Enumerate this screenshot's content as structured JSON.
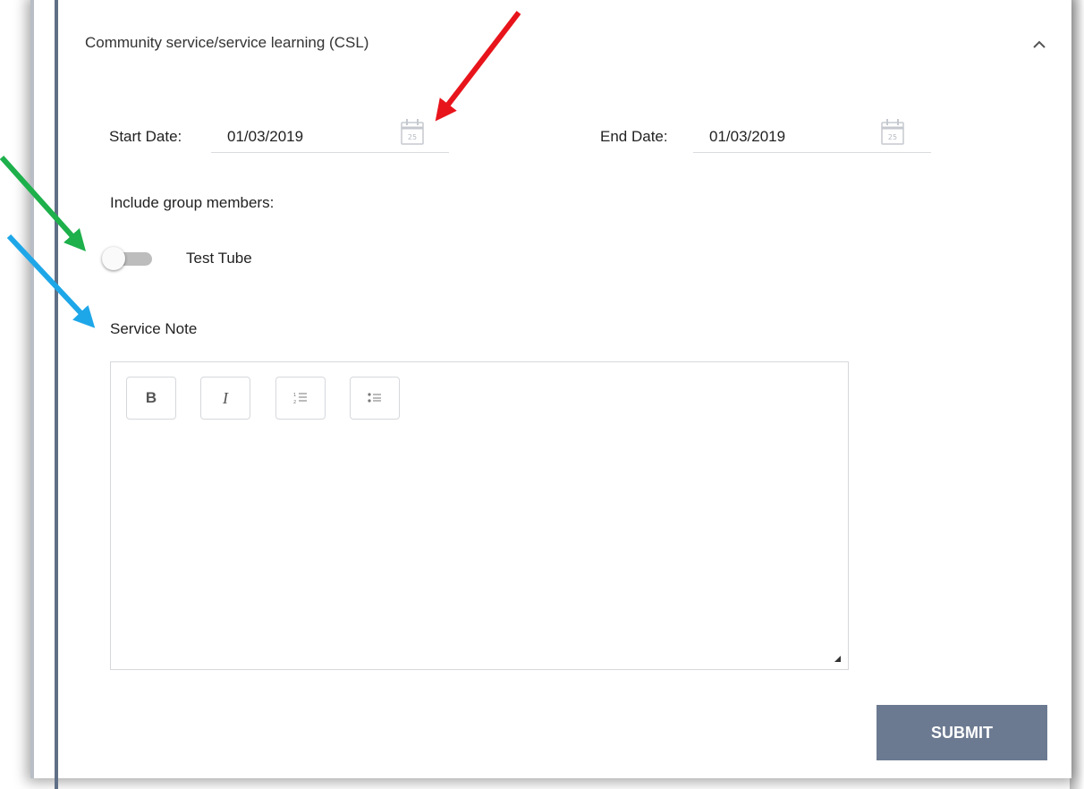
{
  "section": {
    "title": "Community service/service learning (CSL)"
  },
  "dates": {
    "start_label": "Start Date:",
    "start_value": "01/03/2019",
    "end_label": "End Date:",
    "end_value": "01/03/2019",
    "calendar_day": "25"
  },
  "group": {
    "label": "Include group members:",
    "members": [
      {
        "name": "Test Tube",
        "included": false
      }
    ]
  },
  "note": {
    "label": "Service Note",
    "toolbar": {
      "bold": "B",
      "italic": "I"
    },
    "value": ""
  },
  "actions": {
    "submit_label": "SUBMIT"
  },
  "colors": {
    "accent_bar": "#5f6f86",
    "submit_bg": "#6c7a91",
    "arrow_red": "#e8141b",
    "arrow_green": "#1db04b",
    "arrow_blue": "#1ea7e8"
  }
}
